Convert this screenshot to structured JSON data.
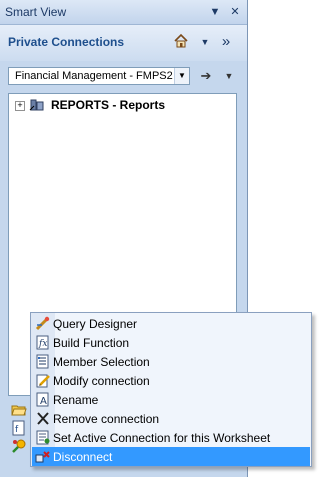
{
  "panel": {
    "title": "Smart View",
    "title_menu_glyph": "▼",
    "close_glyph": "✕",
    "heading": "Private Connections",
    "home_icon": "home-icon",
    "home_drop_glyph": "▼",
    "collapse_glyph": "»"
  },
  "connection": {
    "selected": "Financial Management - FMPS2",
    "go_glyph": "➔",
    "menu_glyph": "▼"
  },
  "tree": {
    "items": [
      {
        "label": "REPORTS - Reports",
        "expander": "+"
      }
    ]
  },
  "context_menu": {
    "items": [
      {
        "label": "Query Designer",
        "icon": "query-designer-icon"
      },
      {
        "label": "Build Function",
        "icon": "build-function-icon"
      },
      {
        "label": "Member Selection",
        "icon": "member-selection-icon"
      },
      {
        "label": "Modify connection",
        "icon": "modify-connection-icon"
      },
      {
        "label": "Rename",
        "icon": "rename-icon"
      },
      {
        "label": "Remove connection",
        "icon": "remove-icon"
      },
      {
        "label": "Set Active Connection for this Worksheet",
        "icon": "set-active-icon"
      },
      {
        "label": "Disconnect",
        "icon": "disconnect-icon",
        "highlighted": true
      }
    ]
  },
  "colors": {
    "panel_bg": "#c5d7ed",
    "heading": "#1e4f8d",
    "menu_highlight": "#3399ff"
  }
}
